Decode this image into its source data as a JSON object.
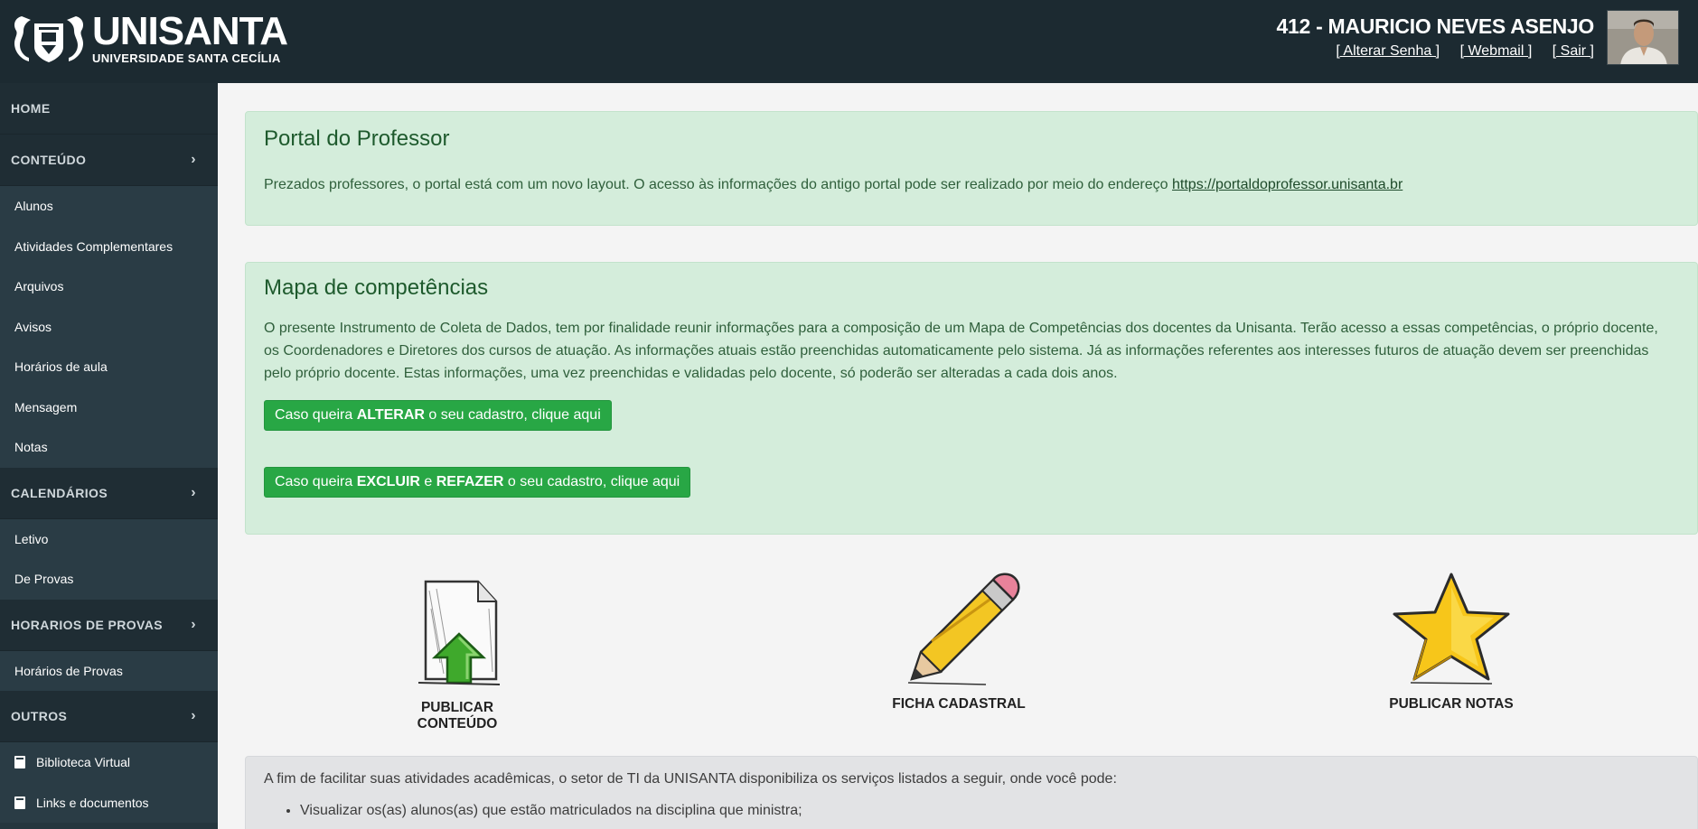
{
  "header": {
    "logo_title": "UNISANTA",
    "logo_subtitle": "UNIVERSIDADE SANTA CECÍLIA",
    "user_name": "412 - MAURICIO NEVES ASENJO",
    "links": [
      "[ Alterar Senha ]",
      "[ Webmail ]",
      "[ Sair ]"
    ]
  },
  "sidebar": {
    "home": "HOME",
    "sections": [
      {
        "label": "CONTEÚDO",
        "items": [
          "Alunos",
          "Atividades Complementares",
          "Arquivos",
          "Avisos",
          "Horários de aula",
          "Mensagem",
          "Notas"
        ]
      },
      {
        "label": "CALENDÁRIOS",
        "items": [
          "Letivo",
          "De Provas"
        ]
      },
      {
        "label": "HORARIOS DE PROVAS",
        "items": [
          "Horários de Provas"
        ]
      },
      {
        "label": "OUTROS",
        "items": [
          "Biblioteca Virtual",
          "Links e documentos"
        ]
      }
    ],
    "chevron": "›"
  },
  "portal": {
    "title": "Portal do Professor",
    "text": "Prezados professores, o portal está com um novo layout. O acesso às informações do antigo portal pode ser realizado por meio do endereço",
    "link": "https://portaldoprofessor.unisanta.br"
  },
  "mapa": {
    "title": "Mapa de competências",
    "text": "O presente Instrumento de Coleta de Dados, tem por finalidade reunir informações para a composição de um Mapa de Competências dos docentes da Unisanta. Terão acesso a essas competências, o próprio docente, os Coordenadores e Diretores dos cursos de atuação. As informações atuais estão preenchidas automaticamente pelo sistema. Já as informações referentes aos interesses futuros de atuação devem ser preenchidas pelo próprio docente. Estas informações, uma vez preenchidas e validadas pelo docente, só poderão ser alteradas a cada dois anos.",
    "btn_alterar": {
      "pre": "Caso queira ",
      "bold": "ALTERAR",
      "post": " o seu cadastro, clique aqui"
    },
    "btn_excluir": {
      "pre": "Caso queira ",
      "bold1": "EXCLUIR",
      "mid": " e ",
      "bold2": "REFAZER",
      "post": " o seu cadastro, clique aqui"
    }
  },
  "tiles": [
    {
      "label": "PUBLICAR CONTEÚDO",
      "icon": "upload-file-icon"
    },
    {
      "label": "FICHA CADASTRAL",
      "icon": "pencil-icon"
    },
    {
      "label": "PUBLICAR NOTAS",
      "icon": "star-icon"
    }
  ],
  "info": {
    "text": "A fim de facilitar suas atividades acadêmicas, o setor de TI da UNISANTA disponibiliza os serviços listados a seguir, onde você pode:",
    "bullets": [
      "Visualizar os(as) alunos(as) que estão matriculados na disciplina que ministra;"
    ]
  },
  "colors": {
    "header_bg": "#1c2a31",
    "sidebar_bg": "#25363e",
    "panel_green": "#d4eddb",
    "button_green": "#28a745"
  }
}
